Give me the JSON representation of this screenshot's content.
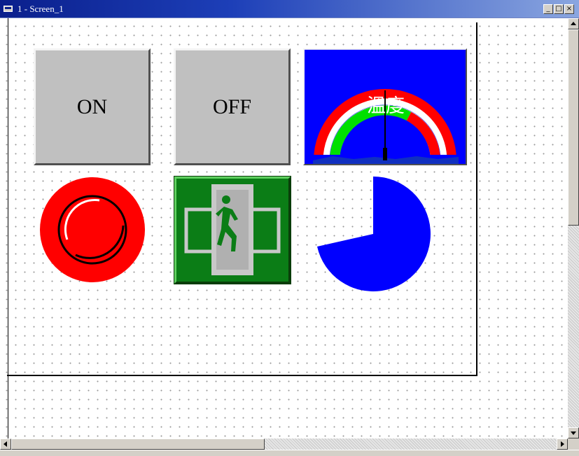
{
  "window": {
    "title": "1 - Screen_1",
    "controls": {
      "minimize": "_",
      "maximize": "□",
      "close": "×"
    }
  },
  "buttons": {
    "on_label": "ON",
    "off_label": "OFF"
  },
  "gauge": {
    "label": "溫度",
    "colors": {
      "background": "#0000ff",
      "outer_ring": "#ff0000",
      "inner_ring": "#00ff00",
      "ring_gap": "#ffffff"
    }
  },
  "objects": {
    "red_button": {
      "color": "#ff0000",
      "icon": "red-push-button"
    },
    "exit_sign": {
      "color": "#0b7d16",
      "icon": "emergency-exit-icon"
    },
    "pie": {
      "color": "#0000ff",
      "filled_fraction": 0.8
    }
  }
}
